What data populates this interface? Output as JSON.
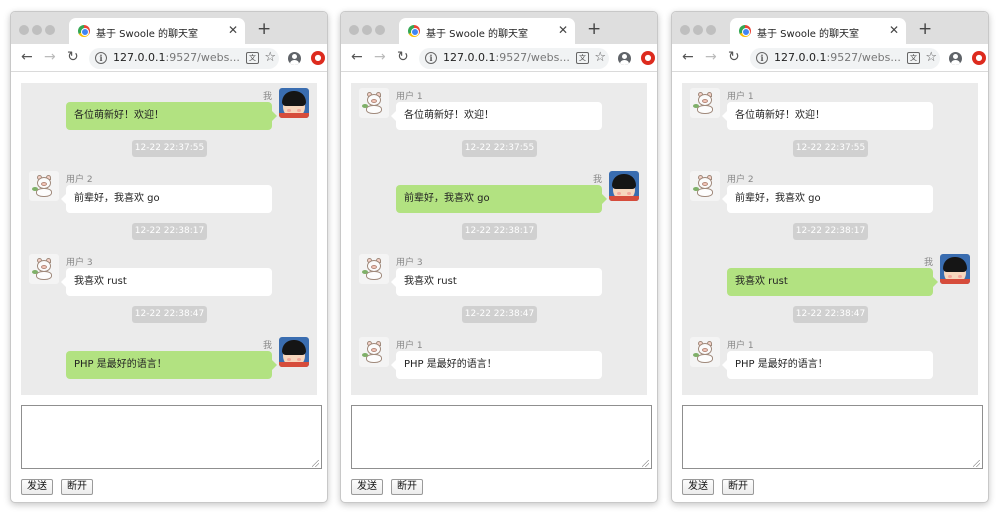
{
  "windows": [
    {
      "tab_title": "基于 Swoole 的聊天室",
      "url_host": "127.0.0.1",
      "url_rest": ":9527/webs...",
      "messages": [
        {
          "type": "msg",
          "mine": true,
          "sender": "我",
          "text": "各位萌新好！欢迎！"
        },
        {
          "type": "time",
          "text": "12-22 22:37:55"
        },
        {
          "type": "msg",
          "mine": false,
          "sender": "用户 2",
          "text": "前辈好，我喜欢 go"
        },
        {
          "type": "time",
          "text": "12-22 22:38:17"
        },
        {
          "type": "msg",
          "mine": false,
          "sender": "用户 3",
          "text": "我喜欢 rust"
        },
        {
          "type": "time",
          "text": "12-22 22:38:47"
        },
        {
          "type": "msg",
          "mine": true,
          "sender": "我",
          "text": "PHP 是最好的语言！"
        }
      ],
      "buttons": {
        "send": "发送",
        "disconnect": "断开"
      }
    },
    {
      "tab_title": "基于 Swoole 的聊天室",
      "url_host": "127.0.0.1",
      "url_rest": ":9527/webs...",
      "messages": [
        {
          "type": "msg",
          "mine": false,
          "sender": "用户 1",
          "text": "各位萌新好！欢迎！"
        },
        {
          "type": "time",
          "text": "12-22 22:37:55"
        },
        {
          "type": "msg",
          "mine": true,
          "sender": "我",
          "text": "前辈好，我喜欢 go"
        },
        {
          "type": "time",
          "text": "12-22 22:38:17"
        },
        {
          "type": "msg",
          "mine": false,
          "sender": "用户 3",
          "text": "我喜欢 rust"
        },
        {
          "type": "time",
          "text": "12-22 22:38:47"
        },
        {
          "type": "msg",
          "mine": false,
          "sender": "用户 1",
          "text": "PHP 是最好的语言！"
        }
      ],
      "buttons": {
        "send": "发送",
        "disconnect": "断开"
      }
    },
    {
      "tab_title": "基于 Swoole 的聊天室",
      "url_host": "127.0.0.1",
      "url_rest": ":9527/webs...",
      "messages": [
        {
          "type": "msg",
          "mine": false,
          "sender": "用户 1",
          "text": "各位萌新好！欢迎！"
        },
        {
          "type": "time",
          "text": "12-22 22:37:55"
        },
        {
          "type": "msg",
          "mine": false,
          "sender": "用户 2",
          "text": "前辈好，我喜欢 go"
        },
        {
          "type": "time",
          "text": "12-22 22:38:17"
        },
        {
          "type": "msg",
          "mine": true,
          "sender": "我",
          "text": "我喜欢 rust"
        },
        {
          "type": "time",
          "text": "12-22 22:38:47"
        },
        {
          "type": "msg",
          "mine": false,
          "sender": "用户 1",
          "text": "PHP 是最好的语言！"
        }
      ],
      "buttons": {
        "send": "发送",
        "disconnect": "断开"
      }
    }
  ],
  "icons": {
    "back": "arrow-left-icon",
    "forward": "arrow-right-icon",
    "reload": "reload-icon",
    "info": "info-icon",
    "translate": "translate-icon",
    "bookmark": "star-icon",
    "account": "account-icon",
    "extension": "extension-icon",
    "favicon": "favicon-icon",
    "close": "close-icon",
    "new_tab": "plus-icon"
  },
  "colors": {
    "my_bubble": "#b2e281",
    "other_bubble": "#ffffff",
    "chat_background": "#ebebeb",
    "timestamp_pill": "#d0d0d0"
  }
}
